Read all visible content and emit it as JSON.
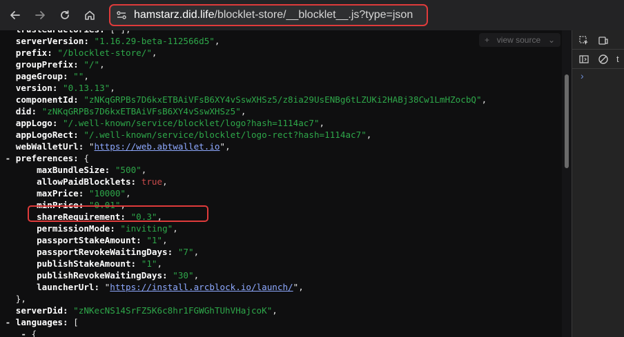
{
  "browser": {
    "url_host": "hamstarz.did.life",
    "url_path": "/blocklet-store/__blocklet__.js?type=json",
    "icons": [
      "back-icon",
      "forward-icon",
      "reload-icon",
      "home-icon",
      "site-settings-icon"
    ]
  },
  "viewer": {
    "view_source_label": "view source",
    "lines": [
      {
        "key": "trustedFactories",
        "tail": "[ ],"
      },
      {
        "key": "serverVersion",
        "value": "\"1.16.29-beta-112566d5\""
      },
      {
        "key": "prefix",
        "value": "\"/blocklet-store/\""
      },
      {
        "key": "groupPrefix",
        "value": "\"/\""
      },
      {
        "key": "pageGroup",
        "value": "\"\""
      },
      {
        "key": "version",
        "value": "\"0.13.13\""
      },
      {
        "key": "componentId",
        "value": "\"zNKqGRPBs7D6kxETBAiVFsB6XY4vSswXHSz5/z8ia29UsENBg6tLZUKi2HABj38Cw1LmHZocbQ\""
      },
      {
        "key": "did",
        "value": "\"zNKqGRPBs7D6kxETBAiVFsB6XY4vSswXHSz5\""
      },
      {
        "key": "appLogo",
        "value": "\"/.well-known/service/blocklet/logo?hash=1114ac7\""
      },
      {
        "key": "appLogoRect",
        "value": "\"/.well-known/service/blocklet/logo-rect?hash=1114ac7\""
      },
      {
        "key": "webWalletUrl",
        "link": "https://web.abtwallet.io"
      },
      {
        "key": "preferences",
        "open": "{"
      },
      {
        "key": "maxBundleSize",
        "value": "\"500\""
      },
      {
        "key": "allowPaidBlocklets",
        "bool": "true"
      },
      {
        "key": "maxPrice",
        "value": "\"10000\""
      },
      {
        "key": "minPrice",
        "value": "\"0.01\""
      },
      {
        "key": "shareRequirement",
        "value": "\"0.3\""
      },
      {
        "key": "permissionMode",
        "value": "\"inviting\""
      },
      {
        "key": "passportStakeAmount",
        "value": "\"1\""
      },
      {
        "key": "passportRevokeWaitingDays",
        "value": "\"7\""
      },
      {
        "key": "publishStakeAmount",
        "value": "\"1\""
      },
      {
        "key": "publishRevokeWaitingDays",
        "value": "\"30\""
      },
      {
        "key": "launcherUrl",
        "link": "https://install.arcblock.io/launch/"
      },
      {
        "close": "},"
      },
      {
        "key": "serverDid",
        "value": "\"zNKecNS14SrFZ5K6c8hr1FGWGhTUhVHajcoK\""
      },
      {
        "key": "languages",
        "open": "["
      },
      {
        "open_only": "{"
      }
    ]
  },
  "devtools": {
    "icons": [
      "inspect-icon",
      "device-toggle-icon",
      "sidebar-icon",
      "clear-icon"
    ],
    "prompt": "›",
    "clipped_label": "t"
  }
}
